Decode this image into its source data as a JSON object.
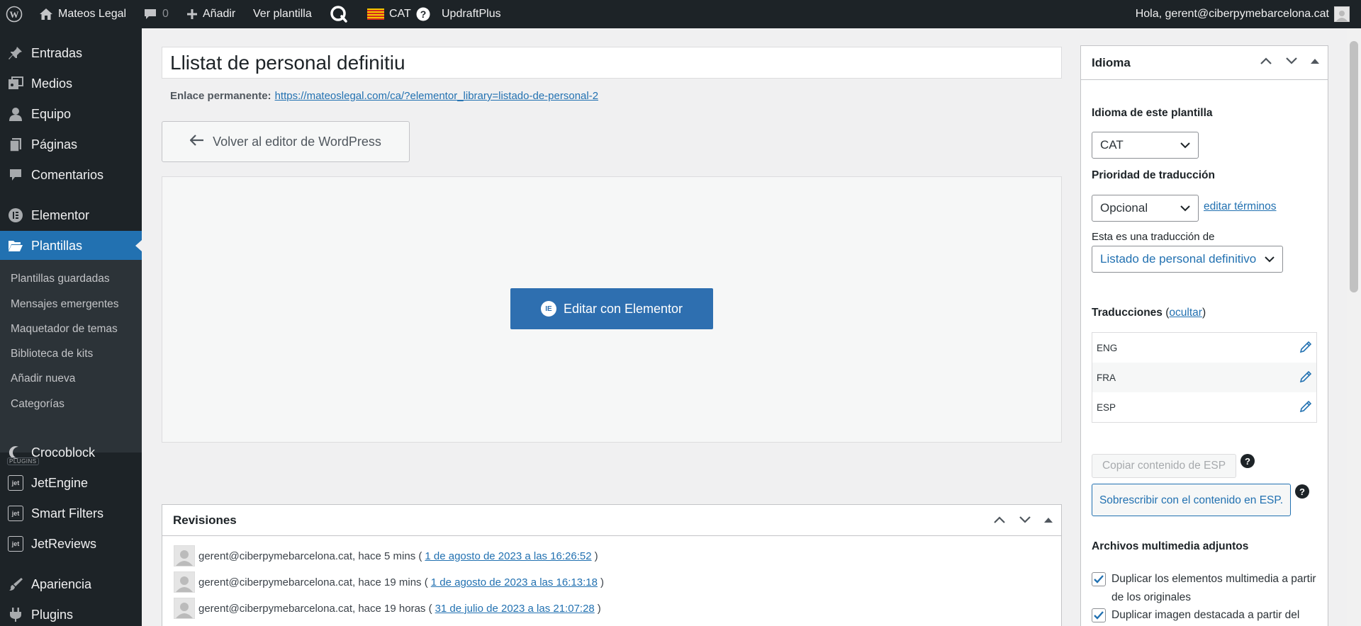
{
  "adminbar": {
    "site_name": "Mateos Legal",
    "comments_count": "0",
    "add_label": "Añadir",
    "view_label": "Ver plantilla",
    "lang_label": "CAT",
    "updraft_label": "UpdraftPlus",
    "greeting": "Hola, gerent@ciberpymebarcelona.cat"
  },
  "sidebar": {
    "items": [
      {
        "label": "Entradas",
        "icon": "pin-icon"
      },
      {
        "label": "Medios",
        "icon": "media-icon"
      },
      {
        "label": "Equipo",
        "icon": "user-icon"
      },
      {
        "label": "Páginas",
        "icon": "pages-icon"
      },
      {
        "label": "Comentarios",
        "icon": "comment-icon"
      },
      {
        "label": "Elementor",
        "icon": "elementor-icon"
      },
      {
        "label": "Plantillas",
        "icon": "folder-icon"
      },
      {
        "label": "Crocoblock",
        "icon": "crocoblock-icon"
      },
      {
        "label": "JetEngine",
        "icon": "jet-icon"
      },
      {
        "label": "Smart Filters",
        "icon": "jet-icon"
      },
      {
        "label": "JetReviews",
        "icon": "jet-icon"
      },
      {
        "label": "Apariencia",
        "icon": "brush-icon"
      },
      {
        "label": "Plugins",
        "icon": "plugin-icon"
      }
    ],
    "submenu": [
      "Plantillas guardadas",
      "Mensajes emergentes",
      "Maquetador de temas",
      "Biblioteca de kits",
      "Añadir nueva",
      "Categorías"
    ],
    "plugins_tag": "PLUGINS"
  },
  "main": {
    "title_value": "Llistat de personal definitiu",
    "permalink_label": "Enlace permanente:",
    "permalink_url": "https://mateoslegal.com/ca/?elementor_library=listado-de-personal-2",
    "back_button": "Volver al editor de WordPress",
    "elementor_button": "Editar con Elementor"
  },
  "revisions": {
    "title": "Revisiones",
    "rows": [
      {
        "text": "gerent@ciberpymebarcelona.cat, hace 5 mins (",
        "link": "1 de agosto de 2023 a las 16:26:52",
        "close": ")"
      },
      {
        "text": "gerent@ciberpymebarcelona.cat, hace 19 mins (",
        "link": "1 de agosto de 2023 a las 16:13:18",
        "close": ")"
      },
      {
        "text": "gerent@ciberpymebarcelona.cat, hace 19 horas (",
        "link": "31 de julio de 2023 a las 21:07:28",
        "close": ")"
      }
    ]
  },
  "language_box": {
    "title": "Idioma",
    "template_lang_label": "Idioma de este plantilla",
    "template_lang_value": "CAT",
    "priority_label": "Prioridad de traducción",
    "priority_value": "Opcional",
    "edit_terms": "editar términos",
    "translation_of_label": "Esta es una traducción de",
    "translation_of_value": "Listado de personal definitivo",
    "translations_label": "Traducciones",
    "hide_open": "(",
    "hide_link": "ocultar",
    "hide_close": ")",
    "translations": [
      "ENG",
      "FRA",
      "ESP"
    ],
    "copy_button": "Copiar contenido de ESP",
    "overwrite_button": "Sobrescribir con el contenido en ESP.",
    "media_label": "Archivos multimedia adjuntos",
    "checkbox1": "Duplicar los elementos multimedia a partir de los originales",
    "checkbox2": "Duplicar imagen destacada a partir del original"
  },
  "colors": {
    "admin_dark": "#1d2327",
    "accent": "#2271b1",
    "elementor_blue": "#2e6fb0"
  }
}
